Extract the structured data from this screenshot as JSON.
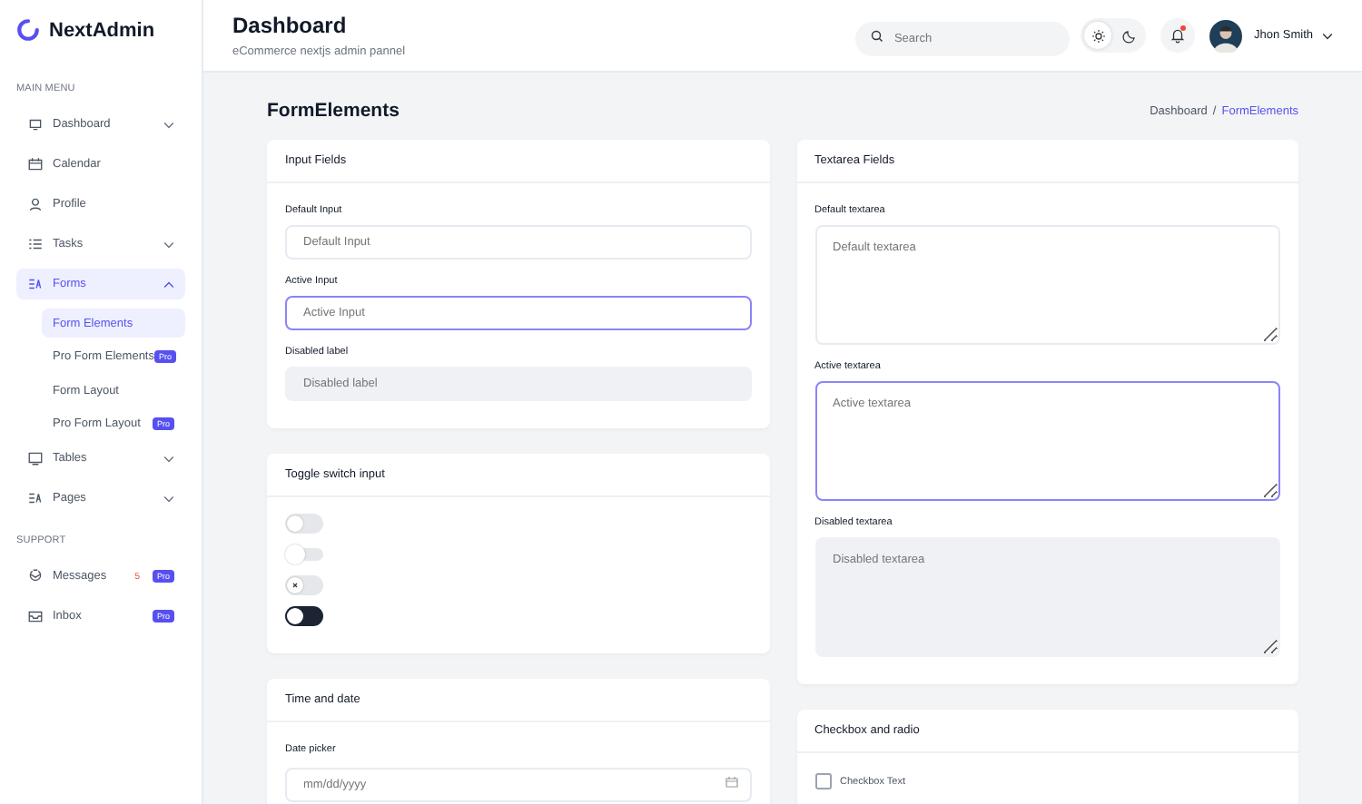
{
  "sidebar": {
    "logo": "NextAdmin",
    "sections": [
      {
        "title": "MAIN MENU",
        "items": [
          {
            "kind": "group",
            "label": "Dashboard",
            "selected": false,
            "expanded": false
          },
          {
            "kind": "link",
            "label": "Calendar",
            "selected": false
          },
          {
            "kind": "link",
            "label": "Profile",
            "selected": false
          },
          {
            "kind": "group",
            "label": "Tasks",
            "selected": false,
            "expanded": false
          },
          {
            "kind": "group",
            "label": "Forms",
            "selected": true,
            "expanded": true,
            "children": [
              {
                "label": "Form Elements",
                "selected": true
              },
              {
                "label": "Pro Form Elements",
                "selected": false,
                "badge": "Pro"
              },
              {
                "label": "Form Layout",
                "selected": false
              },
              {
                "label": "Pro Form Layout",
                "selected": false,
                "badge": "Pro"
              }
            ]
          },
          {
            "kind": "group",
            "label": "Tables",
            "selected": false,
            "expanded": false
          },
          {
            "kind": "group",
            "label": "Pages",
            "selected": false,
            "expanded": false
          }
        ]
      },
      {
        "title": "SUPPORT",
        "items": [
          {
            "kind": "link",
            "label": "Messages",
            "selected": false,
            "count": "5",
            "badge": "Pro"
          },
          {
            "kind": "link",
            "label": "Inbox",
            "selected": false,
            "badge": "Pro"
          }
        ]
      }
    ]
  },
  "header": {
    "title": "Dashboard",
    "subtitle": "eCommerce nextjs admin pannel",
    "search": {
      "placeholder": "Search"
    },
    "theme": [
      {
        "kind": "light",
        "selected": true
      },
      {
        "kind": "dark",
        "selected": false
      }
    ],
    "notifications": {
      "unread": true
    },
    "user": {
      "name": "Jhon Smith"
    }
  },
  "page": {
    "title": "FormElements",
    "separator": "/",
    "breadcrumb": [
      {
        "label": "Dashboard",
        "current": false
      },
      {
        "label": "FormElements",
        "current": true
      }
    ]
  },
  "columns": [
    [
      {
        "title": "Input Fields",
        "items": [
          {
            "kind": "input",
            "label": "Default Input",
            "placeholder": "Default Input",
            "active": false,
            "disabled": false
          },
          {
            "kind": "input",
            "label": "Active Input",
            "placeholder": "Active Input",
            "active": true,
            "disabled": false
          },
          {
            "kind": "input",
            "label": "Disabled label",
            "placeholder": "Disabled label",
            "active": false,
            "disabled": true
          }
        ]
      },
      {
        "title": "Toggle switch input",
        "items": [
          {
            "kind": "toggle",
            "on": false
          },
          {
            "kind": "slim-toggle",
            "on": false
          },
          {
            "kind": "icon-toggle",
            "on": false
          },
          {
            "kind": "dark-toggle",
            "on": false
          }
        ]
      },
      {
        "title": "Time and date",
        "items": [
          {
            "kind": "date",
            "label": "Date picker",
            "placeholder": "mm/dd/yyyy"
          }
        ]
      }
    ],
    [
      {
        "title": "Textarea Fields",
        "items": [
          {
            "kind": "textarea",
            "label": "Default textarea",
            "placeholder": "Default textarea",
            "active": false,
            "disabled": false
          },
          {
            "kind": "textarea",
            "label": "Active textarea",
            "placeholder": "Active textarea",
            "active": true,
            "disabled": false
          },
          {
            "kind": "textarea",
            "label": "Disabled textarea",
            "placeholder": "Disabled textarea",
            "active": false,
            "disabled": true
          }
        ]
      },
      {
        "title": "Checkbox and radio",
        "items": [
          {
            "kind": "checkbox",
            "label": "Checkbox Text",
            "checked": false
          }
        ]
      }
    ]
  ]
}
